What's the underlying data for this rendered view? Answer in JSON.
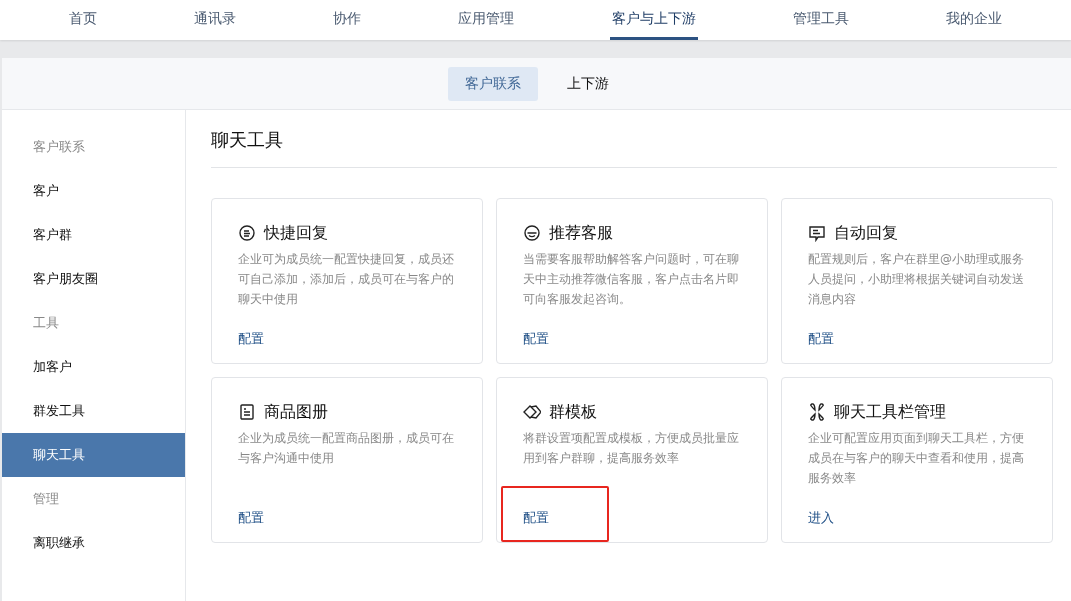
{
  "top_nav": [
    {
      "label": "首页",
      "selected": false
    },
    {
      "label": "通讯录",
      "selected": false
    },
    {
      "label": "协作",
      "selected": false
    },
    {
      "label": "应用管理",
      "selected": false
    },
    {
      "label": "客户与上下游",
      "selected": true
    },
    {
      "label": "管理工具",
      "selected": false
    },
    {
      "label": "我的企业",
      "selected": false
    }
  ],
  "sub_tabs": [
    {
      "label": "客户联系",
      "selected": true
    },
    {
      "label": "上下游",
      "selected": false
    }
  ],
  "sidebar": [
    {
      "kind": "header",
      "label": "客户联系"
    },
    {
      "kind": "item",
      "label": "客户",
      "selected": false
    },
    {
      "kind": "item",
      "label": "客户群",
      "selected": false
    },
    {
      "kind": "item",
      "label": "客户朋友圈",
      "selected": false
    },
    {
      "kind": "header",
      "label": "工具"
    },
    {
      "kind": "item",
      "label": "加客户",
      "selected": false
    },
    {
      "kind": "item",
      "label": "群发工具",
      "selected": false
    },
    {
      "kind": "item",
      "label": "聊天工具",
      "selected": true
    },
    {
      "kind": "header",
      "label": "管理"
    },
    {
      "kind": "item",
      "label": "离职继承",
      "selected": false
    }
  ],
  "page_title": "聊天工具",
  "cards": [
    {
      "kind": "bubble",
      "title": "快捷回复",
      "description": "企业可为成员统一配置快捷回复，成员还可自己添加，添加后，成员可在与客户的聊天中使用",
      "action": "配置",
      "highlighted": false
    },
    {
      "kind": "service",
      "title": "推荐客服",
      "description": "当需要客服帮助解答客户问题时，可在聊天中主动推荐微信客服，客户点击名片即可向客服发起咨询。",
      "action": "配置",
      "highlighted": false
    },
    {
      "kind": "autoreply",
      "title": "自动回复",
      "description": "配置规则后，客户在群里@小助理或服务人员提问，小助理将根据关键词自动发送消息内容",
      "action": "配置",
      "highlighted": false
    },
    {
      "kind": "album",
      "title": "商品图册",
      "description": "企业为成员统一配置商品图册，成员可在与客户沟通中使用",
      "action": "配置",
      "highlighted": false
    },
    {
      "kind": "diamonds",
      "title": "群模板",
      "description": "将群设置项配置成模板，方便成员批量应用到客户群聊，提高服务效率",
      "action": "配置",
      "highlighted": true
    },
    {
      "kind": "clover",
      "title": "聊天工具栏管理",
      "description": "企业可配置应用页面到聊天工具栏，方便成员在与客户的聊天中查看和使用，提高服务效率",
      "action": "进入",
      "highlighted": false
    }
  ]
}
